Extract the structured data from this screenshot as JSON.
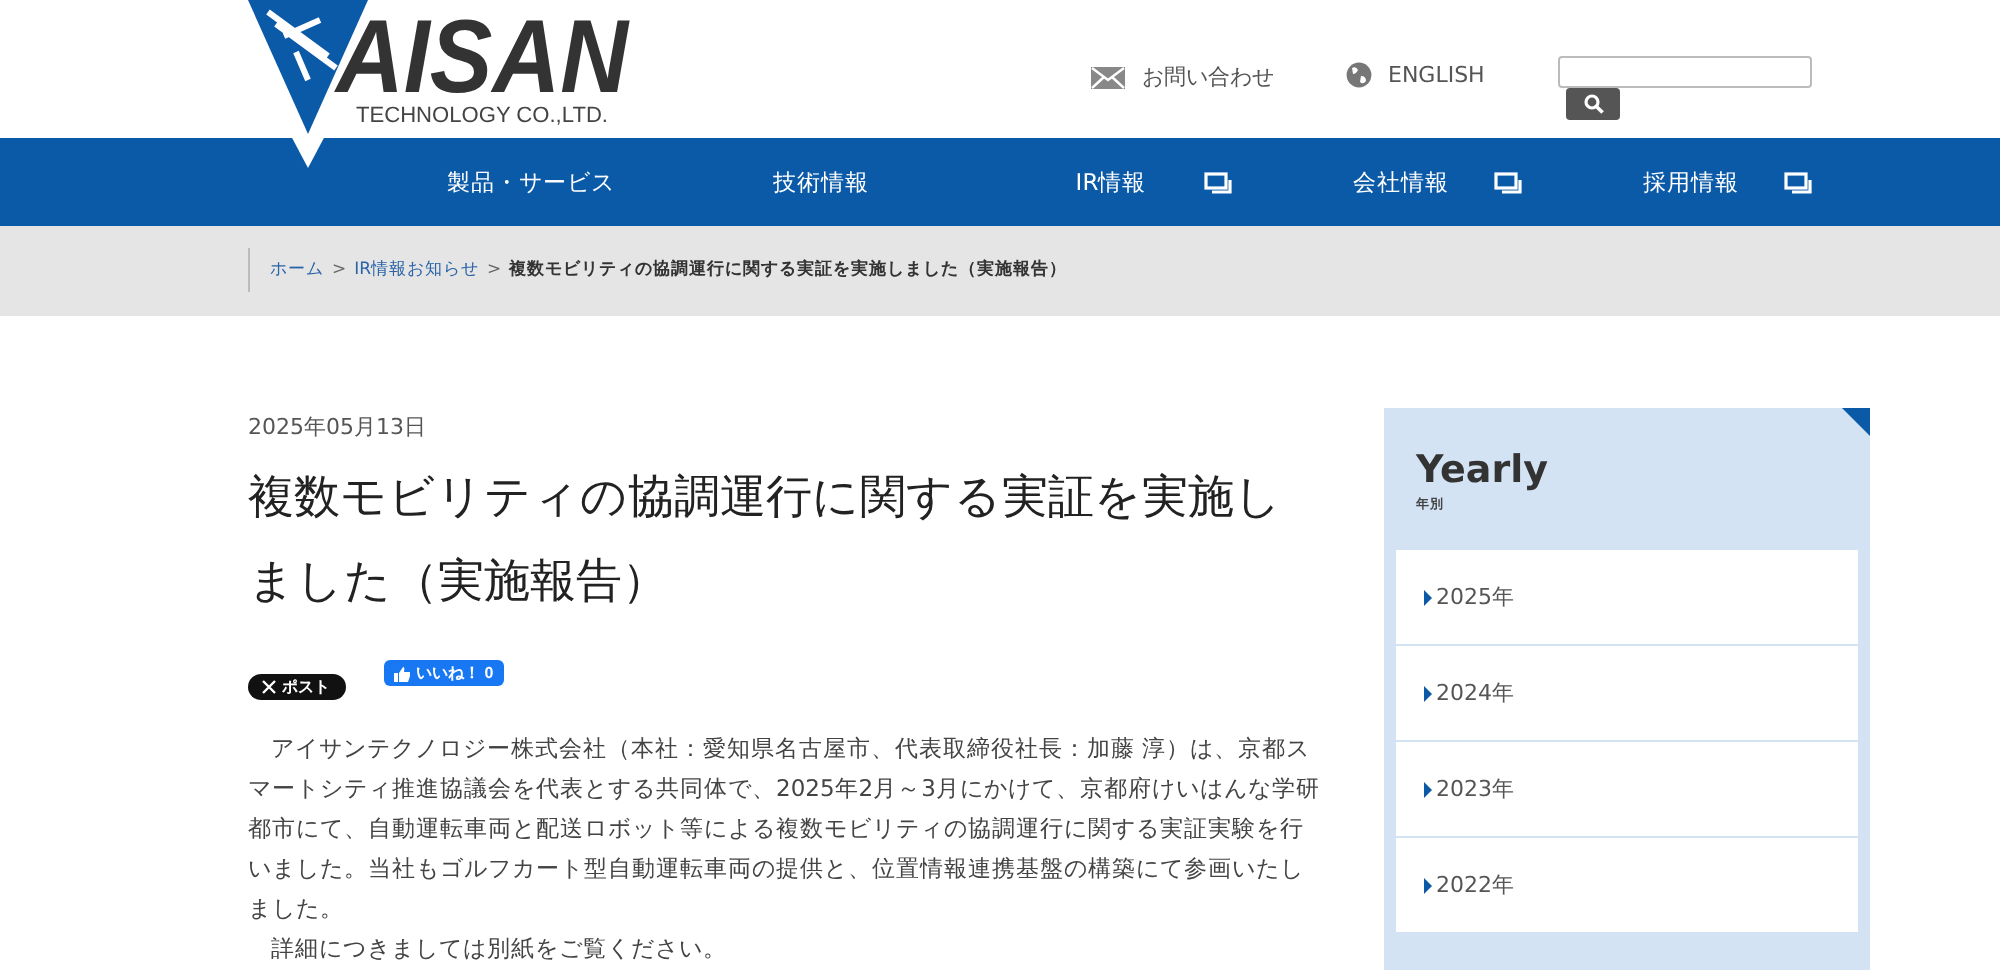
{
  "logo": {
    "name": "AISAN",
    "tagline": "TECHNOLOGY CO.,LTD."
  },
  "utility_links": [
    {
      "kind": "mail",
      "label": "お問い合わせ"
    },
    {
      "kind": "globe",
      "label": "ENGLISH"
    }
  ],
  "nav": [
    {
      "label": "製品・サービス",
      "new_window": false
    },
    {
      "label": "技術情報",
      "new_window": false
    },
    {
      "label": "IR情報",
      "new_window": true
    },
    {
      "label": "会社情報",
      "new_window": true
    },
    {
      "label": "採用情報",
      "new_window": true
    }
  ],
  "breadcrumb": [
    {
      "kind": "link",
      "label": "ホーム"
    },
    {
      "kind": "separator",
      "label": ">"
    },
    {
      "kind": "link",
      "label": "IR情報お知らせ"
    },
    {
      "kind": "separator",
      "label": ">"
    },
    {
      "kind": "current",
      "label": "複数モビリティの協調運行に関する実証を実施しました（実施報告）"
    }
  ],
  "article": {
    "date": "2025年05月13日",
    "title": "複数モビリティの協調運行に関する実証を実施しました（実施報告）",
    "share": {
      "post_label": "ポスト",
      "like_label": "いいね！",
      "like_count": "0"
    },
    "paragraphs": [
      "アイサンテクノロジー株式会社（本社：愛知県名古屋市、代表取締役社長：加藤 淳）は、京都スマートシティ推進協議会を代表とする共同体で、2025年2月～3月にかけて、京都府けいはんな学研都市にて、自動運転車両と配送ロボット等による複数モビリティの協調運行に関する実証実験を行いました。当社もゴルフカート型自動運転車両の提供と、位置情報連携基盤の構築にて参画いたしました。",
      "詳細につきましては別紙をご覧ください。"
    ]
  },
  "sidebar": {
    "title": "Yearly",
    "subtitle": "年別",
    "items": [
      {
        "label": "2025年"
      },
      {
        "label": "2024年"
      },
      {
        "label": "2023年"
      },
      {
        "label": "2022年"
      }
    ]
  }
}
